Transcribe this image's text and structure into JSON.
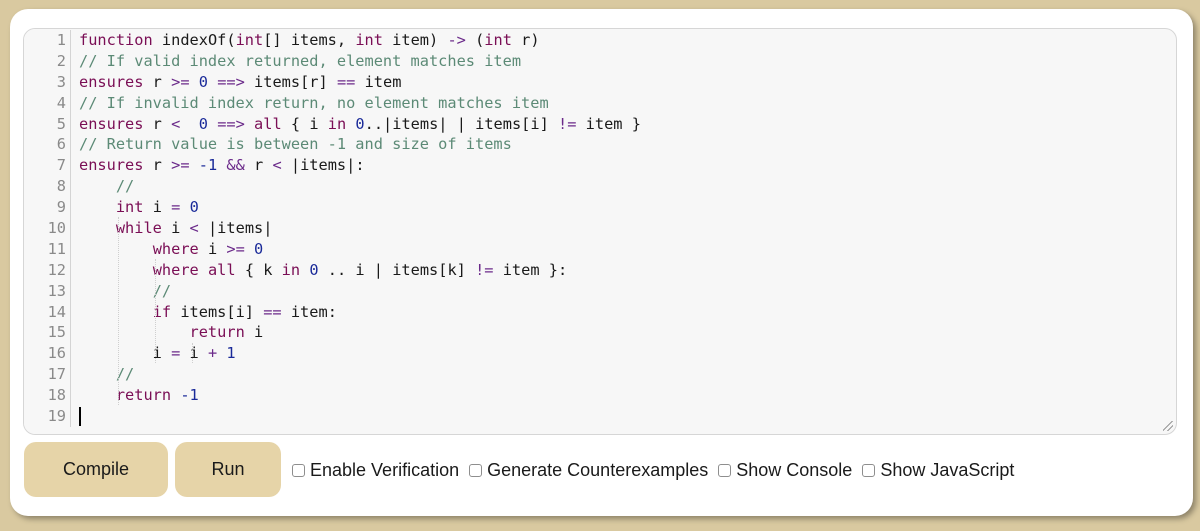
{
  "editor": {
    "lines": [
      {
        "n": "1",
        "tokens": [
          {
            "c": "kw",
            "t": "function"
          },
          {
            "c": "pl",
            "t": " indexOf("
          },
          {
            "c": "kw",
            "t": "int"
          },
          {
            "c": "pl",
            "t": "[] items, "
          },
          {
            "c": "kw",
            "t": "int"
          },
          {
            "c": "pl",
            "t": " item) "
          },
          {
            "c": "op",
            "t": "->"
          },
          {
            "c": "pl",
            "t": " ("
          },
          {
            "c": "kw",
            "t": "int"
          },
          {
            "c": "pl",
            "t": " r)"
          }
        ]
      },
      {
        "n": "2",
        "tokens": [
          {
            "c": "cm",
            "t": "// If valid index returned, element matches item"
          }
        ]
      },
      {
        "n": "3",
        "tokens": [
          {
            "c": "kw",
            "t": "ensures"
          },
          {
            "c": "pl",
            "t": " r "
          },
          {
            "c": "op",
            "t": ">="
          },
          {
            "c": "pl",
            "t": " "
          },
          {
            "c": "num",
            "t": "0"
          },
          {
            "c": "pl",
            "t": " "
          },
          {
            "c": "op",
            "t": "==>"
          },
          {
            "c": "pl",
            "t": " items[r] "
          },
          {
            "c": "op",
            "t": "=="
          },
          {
            "c": "pl",
            "t": " item"
          }
        ]
      },
      {
        "n": "4",
        "tokens": [
          {
            "c": "cm",
            "t": "// If invalid index return, no element matches item"
          }
        ]
      },
      {
        "n": "5",
        "tokens": [
          {
            "c": "kw",
            "t": "ensures"
          },
          {
            "c": "pl",
            "t": " r "
          },
          {
            "c": "op",
            "t": "<"
          },
          {
            "c": "pl",
            "t": "  "
          },
          {
            "c": "num",
            "t": "0"
          },
          {
            "c": "pl",
            "t": " "
          },
          {
            "c": "op",
            "t": "==>"
          },
          {
            "c": "pl",
            "t": " "
          },
          {
            "c": "kw",
            "t": "all"
          },
          {
            "c": "pl",
            "t": " { i "
          },
          {
            "c": "kw",
            "t": "in"
          },
          {
            "c": "pl",
            "t": " "
          },
          {
            "c": "num",
            "t": "0"
          },
          {
            "c": "pl",
            "t": "..|items| | items[i] "
          },
          {
            "c": "op",
            "t": "!="
          },
          {
            "c": "pl",
            "t": " item }"
          }
        ]
      },
      {
        "n": "6",
        "tokens": [
          {
            "c": "cm",
            "t": "// Return value is between -1 and size of items"
          }
        ]
      },
      {
        "n": "7",
        "tokens": [
          {
            "c": "kw",
            "t": "ensures"
          },
          {
            "c": "pl",
            "t": " r "
          },
          {
            "c": "op",
            "t": ">="
          },
          {
            "c": "pl",
            "t": " "
          },
          {
            "c": "num",
            "t": "-1"
          },
          {
            "c": "pl",
            "t": " "
          },
          {
            "c": "op",
            "t": "&&"
          },
          {
            "c": "pl",
            "t": " r "
          },
          {
            "c": "op",
            "t": "<"
          },
          {
            "c": "pl",
            "t": " |items|:"
          }
        ]
      },
      {
        "n": "8",
        "tokens": [
          {
            "c": "pl",
            "t": "    "
          },
          {
            "c": "cm",
            "t": "//"
          }
        ]
      },
      {
        "n": "9",
        "tokens": [
          {
            "c": "pl",
            "t": "    "
          },
          {
            "c": "kw",
            "t": "int"
          },
          {
            "c": "pl",
            "t": " i "
          },
          {
            "c": "op",
            "t": "="
          },
          {
            "c": "pl",
            "t": " "
          },
          {
            "c": "num",
            "t": "0"
          }
        ]
      },
      {
        "n": "10",
        "tokens": [
          {
            "c": "pl",
            "t": "    "
          },
          {
            "c": "kw",
            "t": "while"
          },
          {
            "c": "pl",
            "t": " i "
          },
          {
            "c": "op",
            "t": "<"
          },
          {
            "c": "pl",
            "t": " |items|"
          }
        ]
      },
      {
        "n": "11",
        "tokens": [
          {
            "c": "pl",
            "t": "        "
          },
          {
            "c": "kw",
            "t": "where"
          },
          {
            "c": "pl",
            "t": " i "
          },
          {
            "c": "op",
            "t": ">="
          },
          {
            "c": "pl",
            "t": " "
          },
          {
            "c": "num",
            "t": "0"
          }
        ]
      },
      {
        "n": "12",
        "tokens": [
          {
            "c": "pl",
            "t": "        "
          },
          {
            "c": "kw",
            "t": "where"
          },
          {
            "c": "pl",
            "t": " "
          },
          {
            "c": "kw",
            "t": "all"
          },
          {
            "c": "pl",
            "t": " { k "
          },
          {
            "c": "kw",
            "t": "in"
          },
          {
            "c": "pl",
            "t": " "
          },
          {
            "c": "num",
            "t": "0"
          },
          {
            "c": "pl",
            "t": " .. i | items[k] "
          },
          {
            "c": "op",
            "t": "!="
          },
          {
            "c": "pl",
            "t": " item }:"
          }
        ]
      },
      {
        "n": "13",
        "tokens": [
          {
            "c": "pl",
            "t": "        "
          },
          {
            "c": "cm",
            "t": "//"
          }
        ]
      },
      {
        "n": "14",
        "tokens": [
          {
            "c": "pl",
            "t": "        "
          },
          {
            "c": "kw",
            "t": "if"
          },
          {
            "c": "pl",
            "t": " items[i] "
          },
          {
            "c": "op",
            "t": "=="
          },
          {
            "c": "pl",
            "t": " item:"
          }
        ]
      },
      {
        "n": "15",
        "tokens": [
          {
            "c": "pl",
            "t": "            "
          },
          {
            "c": "kw",
            "t": "return"
          },
          {
            "c": "pl",
            "t": " i"
          }
        ]
      },
      {
        "n": "16",
        "tokens": [
          {
            "c": "pl",
            "t": "        i "
          },
          {
            "c": "op",
            "t": "="
          },
          {
            "c": "pl",
            "t": " i "
          },
          {
            "c": "op",
            "t": "+"
          },
          {
            "c": "pl",
            "t": " "
          },
          {
            "c": "num",
            "t": "1"
          }
        ]
      },
      {
        "n": "17",
        "tokens": [
          {
            "c": "pl",
            "t": "    "
          },
          {
            "c": "cm",
            "t": "//"
          }
        ]
      },
      {
        "n": "18",
        "tokens": [
          {
            "c": "pl",
            "t": "    "
          },
          {
            "c": "kw",
            "t": "return"
          },
          {
            "c": "pl",
            "t": " "
          },
          {
            "c": "num",
            "t": "-1"
          }
        ]
      },
      {
        "n": "19",
        "tokens": []
      }
    ]
  },
  "toolbar": {
    "compile_label": "Compile",
    "run_label": "Run",
    "options": [
      {
        "label": "Enable Verification",
        "checked": false
      },
      {
        "label": "Generate Counterexamples",
        "checked": false
      },
      {
        "label": "Show Console",
        "checked": false
      },
      {
        "label": "Show JavaScript",
        "checked": false
      }
    ]
  }
}
